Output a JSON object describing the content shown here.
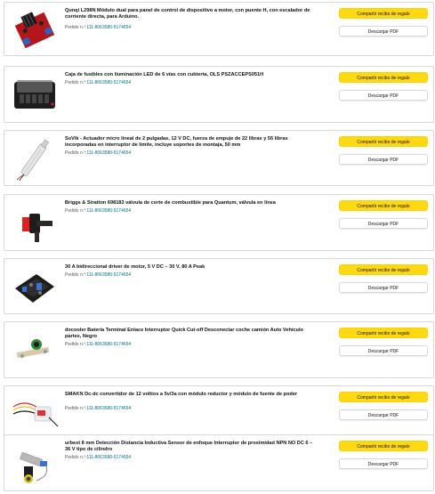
{
  "order_prefix": "Pedido n.º:",
  "order_number": "111-8063580-5174654",
  "buttons": {
    "receipt": "Compartir recibo de regalo",
    "download": "Descargar PDF"
  },
  "items": [
    {
      "title": "Qunqi L298N Módulo dual para panel de control de dispositivo a motor, con puente H, con escalador de corriente directa, para Arduino.",
      "icon": "motor-driver-board-icon"
    },
    {
      "title": "Caja de fusibles con iluminación LED de 6 vías con cubierta, OLS PSZACCEPS051H",
      "icon": "fuse-box-icon"
    },
    {
      "title": "SoVik - Actuador micro lineal de 2 pulgadas, 12 V DC, fuerza de empuje de 22 libras y 55 libras incorporadas en interruptor de límite, incluye soportes de montaja, 50 mm",
      "icon": "linear-actuator-icon"
    },
    {
      "title": "Briggs & Stratton 698183 válvula de corte de combustible para Quantum, válvula en línea",
      "icon": "fuel-valve-icon"
    },
    {
      "title": "30 A bidireccional driver de motor, 5 V DC – 30 V, 80 A Peak",
      "icon": "motor-driver-module-icon"
    },
    {
      "title": "docooler Batería Terminal Enlace Interruptor Quick Cut-off Desconectar coche camión Auto Vehículo partes, Negro",
      "icon": "battery-disconnect-icon"
    },
    {
      "title": "SMAKN Dc-dc convertidor de 12 voltios a 5v/3a con módulo reductor y módulo de fuente de poder",
      "icon": "dc-converter-icon"
    },
    {
      "title": "urbest 8 mm Detección Distancia Inductiva Sensor de enfoque Interruptor de proximidad NPN NO DC 6 – 36 V tipo de cilindro",
      "icon": "proximity-sensor-icon"
    }
  ]
}
